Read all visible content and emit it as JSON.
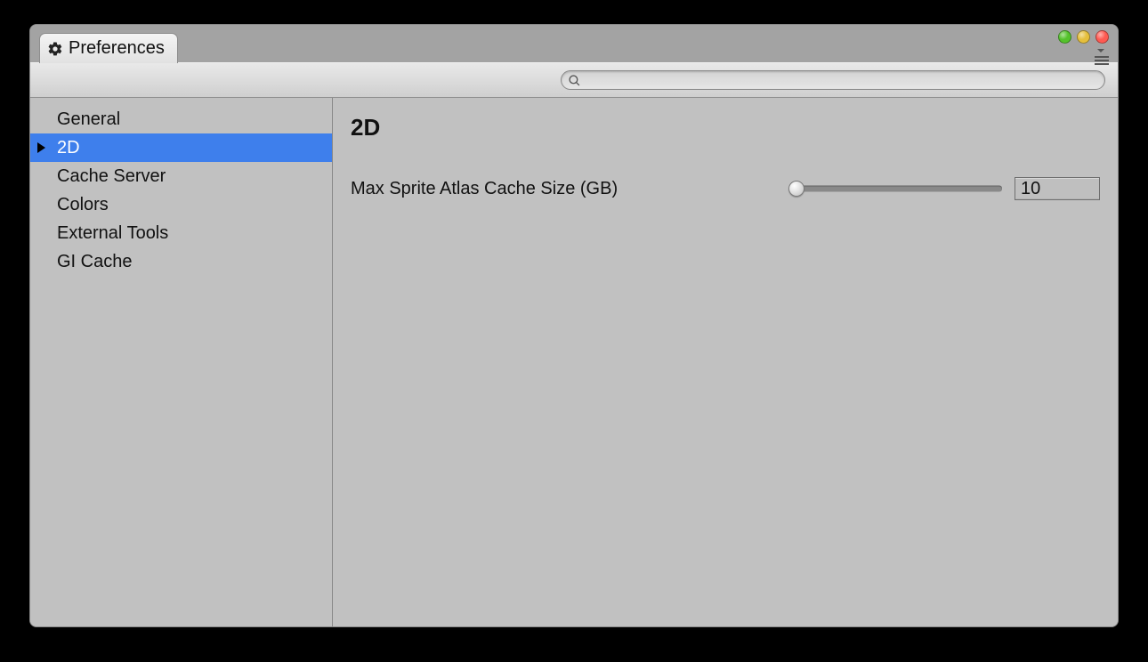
{
  "window": {
    "tab_title": "Preferences",
    "traffic_colors": {
      "close": "#ff5a52",
      "min": "#e5bf3c",
      "max": "#54c22b"
    }
  },
  "search": {
    "value": "",
    "placeholder": ""
  },
  "sidebar": {
    "items": [
      {
        "label": "General",
        "selected": false
      },
      {
        "label": "2D",
        "selected": true
      },
      {
        "label": "Cache Server",
        "selected": false
      },
      {
        "label": "Colors",
        "selected": false
      },
      {
        "label": "External Tools",
        "selected": false
      },
      {
        "label": "GI Cache",
        "selected": false
      }
    ]
  },
  "panel": {
    "heading": "2D",
    "rows": [
      {
        "label": "Max Sprite Atlas Cache Size (GB)",
        "slider_percent": 3,
        "value_text": "10"
      }
    ]
  }
}
